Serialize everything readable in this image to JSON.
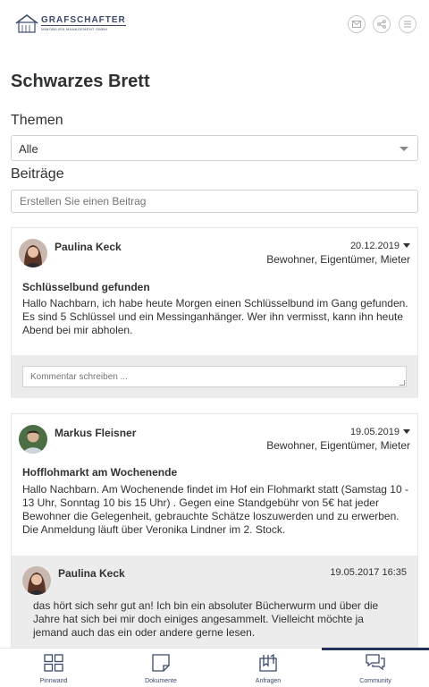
{
  "header": {
    "logo_title": "GRAFSCHAFTER",
    "logo_subtitle": "IMMOBILIEN MANAGEMENT GMBH",
    "icons": [
      "mail-icon",
      "share-icon",
      "menu-icon"
    ]
  },
  "page": {
    "title": "Schwarzes Brett",
    "topics_label": "Themen",
    "topics_selected": "Alle",
    "posts_label": "Beiträge",
    "new_post_placeholder": "Erstellen Sie einen Beitrag"
  },
  "posts": [
    {
      "author": "Paulina Keck",
      "date": "20.12.2019",
      "roles": "Bewohner, Eigentümer, Mieter",
      "title": "Schlüsselbund gefunden",
      "body": "Hallo Nachbarn, ich habe heute Morgen einen Schlüsselbund im Gang gefunden. Es sind 5 Schlüssel und ein Messinganhänger. Wer ihn vermisst, kann ihn heute Abend bei mir abholen.",
      "comment_placeholder": "Kommentar schreiben ..."
    },
    {
      "author": "Markus Fleisner",
      "date": "19.05.2019",
      "roles": "Bewohner, Eigentümer, Mieter",
      "title": "Hofflohmarkt am Wochenende",
      "body": "Hallo Nachbarn. Am Wochenende findet im Hof ein Flohmarkt statt (Samstag 10 - 13 Uhr, Sonntag 10 bis 15 Uhr) . Gegen eine Standgebühr von 5€ hat jeder Bewohner die Gelegenheit, gebrauchte Schätze loszuwerden und zu erwerben. Die Anmeldung läuft über Veronika Lindner im 2. Stock.",
      "comments": [
        {
          "author": "Paulina Keck",
          "date": "19.05.2017 16:35",
          "text": "das hört sich sehr gut an! Ich bin ein absoluter Bücherwurm und über die Jahre hat sich bei mir doch einiges angesammelt. Vielleicht möchte ja jemand auch das ein oder andere gerne lesen."
        }
      ]
    }
  ],
  "bottom_nav": [
    {
      "label": "Pinnwand",
      "icon": "grid-icon"
    },
    {
      "label": "Dokumente",
      "icon": "document-icon"
    },
    {
      "label": "Anfragen",
      "icon": "inbox-icon"
    },
    {
      "label": "Community",
      "icon": "chat-icon",
      "active": true
    }
  ],
  "colors": {
    "accent": "#23305a",
    "comment_bg": "#ececec",
    "border": "#cfd3d7"
  }
}
